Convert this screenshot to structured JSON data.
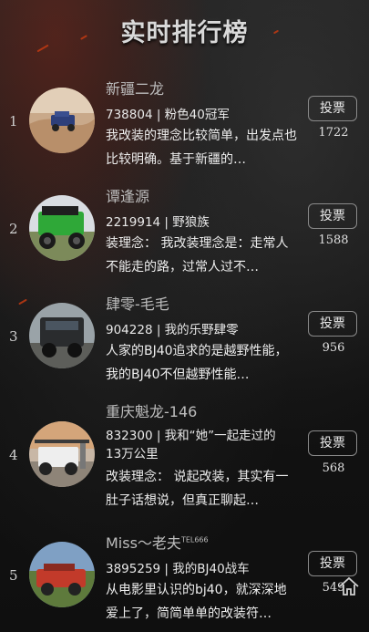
{
  "header": {
    "title": "实时排行榜"
  },
  "entries": [
    {
      "rank": "1",
      "name": "新疆二龙",
      "id_tag": "738804 | 粉色40冠军",
      "desc": "我改装的理念比较简单，出发点也比较明确。基于新疆的…",
      "vote_label": "投票",
      "votes": "1722"
    },
    {
      "rank": "2",
      "name": "谭逢源",
      "id_tag": "2219914 | 野狼族",
      "desc": "装理念： 我改装理念是：走常人不能走的路，过常人过不…",
      "vote_label": "投票",
      "votes": "1588"
    },
    {
      "rank": "3",
      "name": "肆零-毛毛",
      "id_tag": "904228 | 我的乐野肆零",
      "desc": "人家的BJ40追求的是越野性能，我的BJ40不但越野性能…",
      "vote_label": "投票",
      "votes": "956"
    },
    {
      "rank": "4",
      "name": "重庆魁龙-146",
      "id_tag": "832300 | 我和“她”一起走过的13万公里",
      "desc": "改装理念： 说起改装，其实有一肚子话想说，但真正聊起…",
      "vote_label": "投票",
      "votes": "568"
    },
    {
      "rank": "5",
      "name": "Miss～老夫",
      "name_sup": "TEL666",
      "id_tag": "3895259 | 我的BJ40战车",
      "desc": "从电影里认识的bj40，就深深地爱上了，简简单单的改装符…",
      "vote_label": "投票",
      "votes": "549"
    }
  ],
  "back_to_top_icon": "home-up-icon"
}
